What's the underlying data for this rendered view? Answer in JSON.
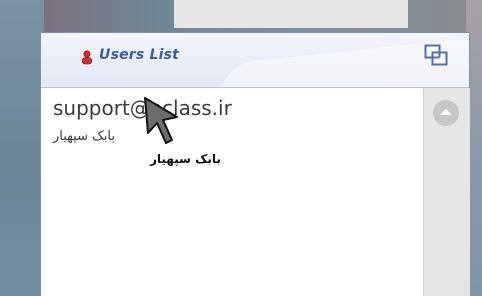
{
  "panel": {
    "title": "Users List",
    "restore_icon": "restore-window-icon",
    "user_icon": "user-icon"
  },
  "list": {
    "items": [
      {
        "email": "support@oclass.ir",
        "name": "بابک سپهیار"
      }
    ]
  },
  "cursor": {
    "label": "بابک سپهیار",
    "icon": "mouse-pointer-icon"
  },
  "colors": {
    "header_text": "#3a5da8",
    "panel_border": "#7b8fb3",
    "text": "#3b3b3b",
    "scrollbar": "#e6e6e6"
  }
}
